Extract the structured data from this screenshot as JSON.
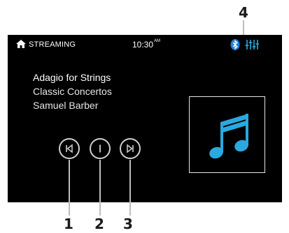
{
  "callouts": {
    "c1": "1",
    "c2": "2",
    "c3": "3",
    "c4": "4"
  },
  "status_bar": {
    "home_icon": "home-icon",
    "title": "STREAMING",
    "time": "10:30",
    "ampm": "AM",
    "bluetooth_icon": "bluetooth-icon",
    "settings_icon": "equalizer-icon"
  },
  "now_playing": {
    "track": "Adagio for Strings",
    "album": "Classic Concertos",
    "artist": "Samuel Barber"
  },
  "controls": {
    "previous_icon": "skip-previous-icon",
    "play_pause_icon": "play-pause-icon",
    "next_icon": "skip-next-icon"
  },
  "album_art": {
    "icon": "music-note-icon"
  },
  "colors": {
    "screen_bg": "#000000",
    "accent_blue": "#2aa8e0",
    "control_ring": "#cfcfcf"
  }
}
